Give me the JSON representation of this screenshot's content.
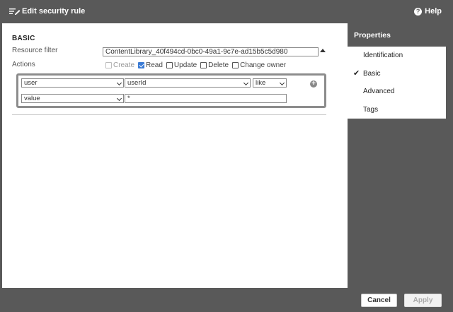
{
  "header": {
    "title": "Edit security rule",
    "help_label": "Help"
  },
  "basic": {
    "section_title": "BASIC",
    "resource_filter_label": "Resource filter",
    "resource_filter_value": "ContentLibrary_40f494cd-0bc0-49a1-9c7e-ad15b5c5d980",
    "actions_label": "Actions",
    "actions": [
      {
        "label": "Create",
        "checked": false,
        "disabled": true
      },
      {
        "label": "Read",
        "checked": true,
        "disabled": false
      },
      {
        "label": "Update",
        "checked": false,
        "disabled": false
      },
      {
        "label": "Delete",
        "checked": false,
        "disabled": false
      },
      {
        "label": "Change owner",
        "checked": false,
        "disabled": false
      }
    ]
  },
  "conditions": {
    "row1": {
      "resource": "user",
      "attribute": "userId",
      "operator": "like"
    },
    "row2": {
      "resource": "value",
      "value": "*"
    }
  },
  "properties": {
    "header": "Properties",
    "items": [
      {
        "label": "Identification",
        "selected": false
      },
      {
        "label": "Basic",
        "selected": true
      },
      {
        "label": "Advanced",
        "selected": false
      },
      {
        "label": "Tags",
        "selected": false
      }
    ]
  },
  "footer": {
    "cancel_label": "Cancel",
    "apply_label": "Apply"
  }
}
